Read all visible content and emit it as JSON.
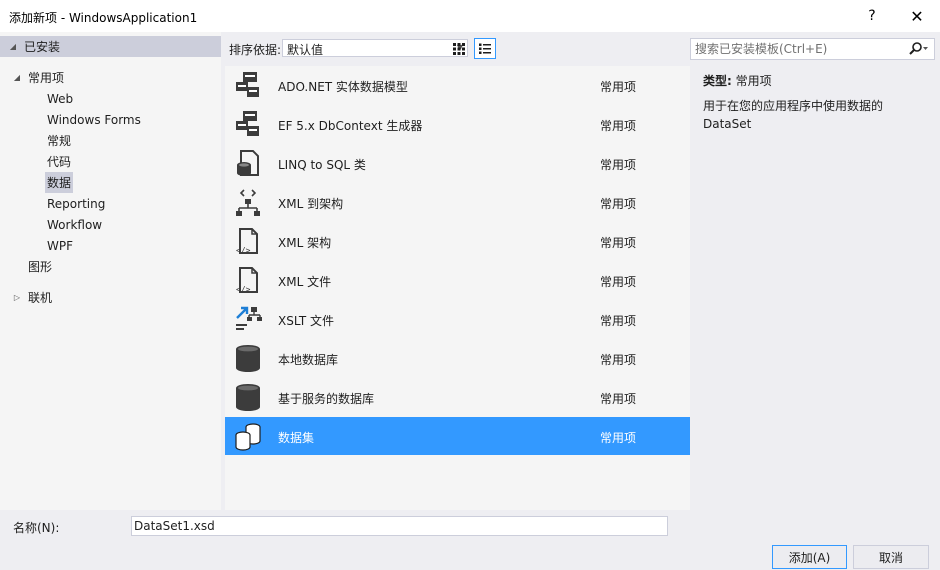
{
  "window": {
    "title": "添加新项 - WindowsApplication1",
    "help_label": "?",
    "close_label": "✕"
  },
  "tree": {
    "installed": "已安装",
    "common": "常用项",
    "children": [
      {
        "label": "Web"
      },
      {
        "label": "Windows Forms"
      },
      {
        "label": "常规"
      },
      {
        "label": "代码"
      },
      {
        "label": "数据"
      },
      {
        "label": "Reporting"
      },
      {
        "label": "Workflow"
      },
      {
        "label": "WPF"
      }
    ],
    "graphics": "图形",
    "online": "联机"
  },
  "sort": {
    "label": "排序依据:",
    "value": "默认值"
  },
  "search": {
    "placeholder": "搜索已安装模板(Ctrl+E)"
  },
  "items": [
    {
      "name": "ADO.NET 实体数据模型",
      "category": "常用项",
      "icon": "ado-entity-model-icon"
    },
    {
      "name": "EF 5.x DbContext 生成器",
      "category": "常用项",
      "icon": "ef-dbcontext-icon"
    },
    {
      "name": "LINQ to SQL 类",
      "category": "常用项",
      "icon": "linq-to-sql-icon"
    },
    {
      "name": "XML 到架构",
      "category": "常用项",
      "icon": "xml-to-schema-icon"
    },
    {
      "name": "XML 架构",
      "category": "常用项",
      "icon": "xml-schema-icon"
    },
    {
      "name": "XML 文件",
      "category": "常用项",
      "icon": "xml-file-icon"
    },
    {
      "name": "XSLT 文件",
      "category": "常用项",
      "icon": "xslt-file-icon"
    },
    {
      "name": "本地数据库",
      "category": "常用项",
      "icon": "local-database-icon"
    },
    {
      "name": "基于服务的数据库",
      "category": "常用项",
      "icon": "service-database-icon"
    },
    {
      "name": "数据集",
      "category": "常用项",
      "icon": "dataset-icon"
    }
  ],
  "selected_item": "数据集",
  "detail": {
    "type_label": "类型:",
    "type_value": "常用项",
    "description": "用于在您的应用程序中使用数据的 DataSet"
  },
  "name_field": {
    "label": "名称(N):",
    "value": "DataSet1.xsd"
  },
  "buttons": {
    "add": "添加(A)",
    "cancel": "取消"
  },
  "colors": {
    "selection": "#3399ff",
    "tree_highlight": "#cccedb",
    "background": "#eeeef2",
    "panel": "#f5f5f5"
  }
}
